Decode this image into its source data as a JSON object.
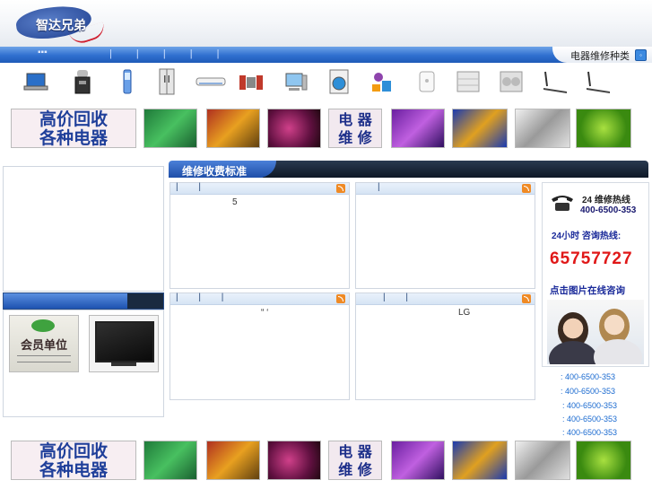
{
  "header": {
    "logo_text": "智达兄弟",
    "nav_dots": "▪▪▪",
    "nav_separators": "| | | | |",
    "category_tab_label": "电器维修种类",
    "category_tab_button": "◦"
  },
  "appliances": [
    {
      "name": "laptop-icon"
    },
    {
      "name": "water-dispenser-icon"
    },
    {
      "name": "mobile-phone-icon"
    },
    {
      "name": "refrigerator-icon"
    },
    {
      "name": "air-conditioner-icon"
    },
    {
      "name": "audio-system-icon"
    },
    {
      "name": "computer-icon"
    },
    {
      "name": "washing-machine-icon"
    },
    {
      "name": "kitchen-appliances-icon"
    },
    {
      "name": "water-heater-icon"
    },
    {
      "name": "central-ac-icon"
    },
    {
      "name": "outdoor-unit-icon"
    },
    {
      "name": "treadmill-icon"
    },
    {
      "name": "treadmill-2-icon"
    }
  ],
  "banner": {
    "recycle_line1": "高价回收",
    "recycle_line2": "各种电器",
    "repair_line1": "电 器",
    "repair_line2": "维 修"
  },
  "center": {
    "section_title": "维修收费标准",
    "panels": [
      {
        "seps": "| |",
        "content": "5"
      },
      {
        "seps": "|",
        "content": ""
      },
      {
        "seps": "| | |",
        "content": "“ ‘"
      },
      {
        "seps": "| |",
        "content": "LG"
      }
    ]
  },
  "left": {
    "member_badge_text": "会员单位"
  },
  "contact": {
    "hotline_label": "24  维修热线",
    "hotline_number": "400-6500-353",
    "hours_label": "24小时  咨询热线:",
    "big_number": "65757727",
    "online_label": "点击图片在线咨询",
    "phone_lines": [
      ": 400-6500-353",
      ": 400-6500-353",
      ": 400-6500-353",
      ": 400-6500-353",
      ": 400-6500-353"
    ]
  },
  "colors": {
    "nav_blue": "#2f6fcf",
    "accent_red": "#e01818",
    "link_blue": "#1a6ad0"
  }
}
